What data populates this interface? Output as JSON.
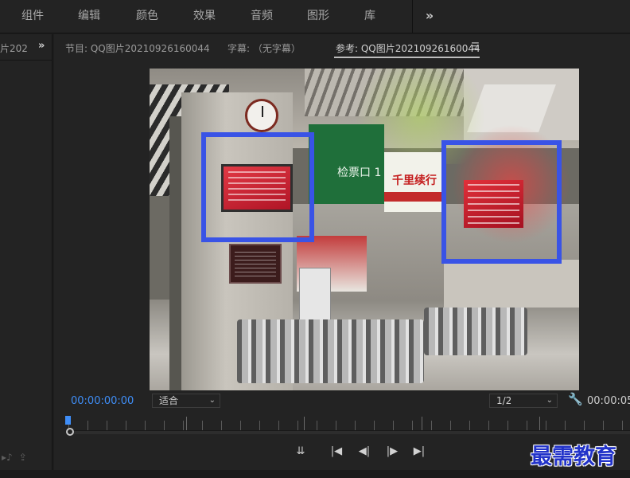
{
  "workspace_menu": {
    "items": [
      "组件",
      "编辑",
      "颜色",
      "效果",
      "音频",
      "图形",
      "库"
    ],
    "more_icon": "double-chevron-right-icon"
  },
  "left_panel": {
    "tab_label": "片202",
    "more_icon": "double-chevron-right-icon",
    "footer_icons": [
      "audio-icon",
      "export-icon"
    ]
  },
  "monitor": {
    "tabs": [
      {
        "label": "节目: QQ图片20210926160044",
        "active": false
      },
      {
        "label": "字幕: （无字幕）",
        "active": false
      },
      {
        "label": "参考: QQ图片20210926160044",
        "active": true
      }
    ],
    "tab_menu_icon": "hamburger-menu-icon",
    "video": {
      "sign_text": "检票口 1",
      "ad_text": "千里续行",
      "highlight_color": "#3953e6"
    },
    "timecode_current": "00:00:00:00",
    "timecode_duration": "00:00:05",
    "fit_dropdown": {
      "value": "适合"
    },
    "resolution_dropdown": {
      "value": "1/2"
    },
    "settings_icon": "wrench-icon",
    "accent_color": "#3f8ef7",
    "transport": {
      "buttons": [
        {
          "name": "insert-button",
          "icon": "insert-icon",
          "glyph": "⇊"
        },
        {
          "name": "go-to-in-button",
          "icon": "step-to-start-icon",
          "glyph": "|◀"
        },
        {
          "name": "step-back-button",
          "icon": "step-back-icon",
          "glyph": "◀|"
        },
        {
          "name": "step-forward-button",
          "icon": "step-forward-icon",
          "glyph": "|▶"
        },
        {
          "name": "go-to-out-button",
          "icon": "step-to-end-icon",
          "glyph": "▶|"
        }
      ]
    }
  },
  "watermark": {
    "text": "最需教育",
    "color": "#2233c9"
  }
}
